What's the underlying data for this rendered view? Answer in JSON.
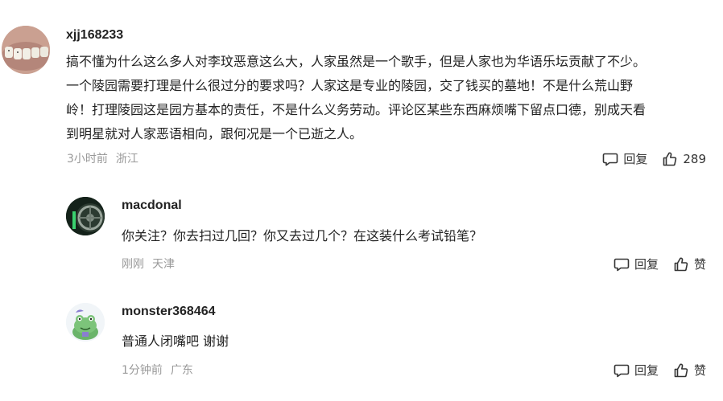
{
  "comments": [
    {
      "username": "xjj168233",
      "content_lines": [
        "搞不懂为什么这么多人对李玟恶意这么大，人家虽然是一个歌手，但是人家也为华语乐坛贡献了不少。",
        "一个陵园需要打理是什么很过分的要求吗？人家这是专业的陵园，交了钱买的墓地！不是什么荒山野",
        "岭！打理陵园这是园方基本的责任，不是什么义务劳动。评论区某些东西麻烦嘴下留点口德，别成天看",
        "到明星就对人家恶语相向，跟何况是一个已逝之人。"
      ],
      "time": "3小时前",
      "location": "浙江",
      "reply_label": "回复",
      "like_label": "289"
    },
    {
      "username": "macdonal",
      "content_lines": [
        "你关注？你去扫过几回？你又去过几个？在这装什么考试铅笔？"
      ],
      "time": "刚刚",
      "location": "天津",
      "reply_label": "回复",
      "like_label": "赞"
    },
    {
      "username": "monster368464",
      "content_lines": [
        "普通人闭嘴吧 谢谢"
      ],
      "time": "1分钟前",
      "location": "广东",
      "reply_label": "回复",
      "like_label": "赞"
    }
  ],
  "icons": {
    "reply": "comment-bubble-icon",
    "like": "thumbs-up-icon"
  },
  "colors": {
    "text": "#222222",
    "meta": "#999999",
    "icon": "#333333"
  }
}
